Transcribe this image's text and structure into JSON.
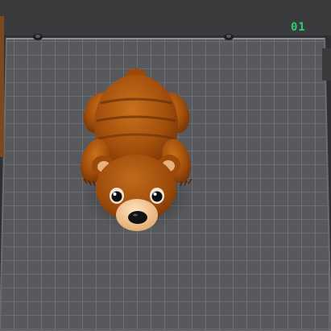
{
  "plate": {
    "label": "01",
    "label_color": "#2ecc71",
    "surface_color": "#58595c",
    "grid_color": "#8a8c90",
    "background_color": "#2f3032"
  },
  "model": {
    "name": "bear-model",
    "body_color": "#a24e0c",
    "snout_color": "#f0bf8d"
  }
}
